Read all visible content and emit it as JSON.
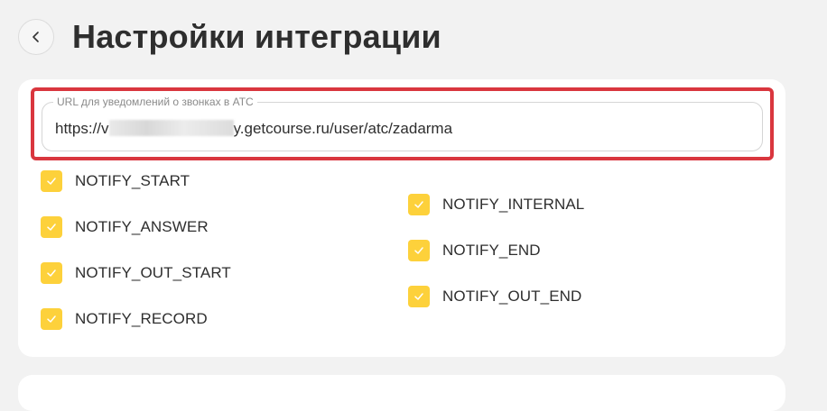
{
  "header": {
    "title": "Настройки интеграции"
  },
  "url_field": {
    "label": "URL для уведомлений о звонках в АТС",
    "value_prefix": "https://v",
    "value_suffix": "y.getcourse.ru/user/atc/zadarma"
  },
  "notifications": {
    "left": [
      {
        "label": "NOTIFY_START",
        "checked": true
      },
      {
        "label": "NOTIFY_ANSWER",
        "checked": true
      },
      {
        "label": "NOTIFY_OUT_START",
        "checked": true
      },
      {
        "label": "NOTIFY_RECORD",
        "checked": true
      }
    ],
    "right": [
      {
        "label": "NOTIFY_INTERNAL",
        "checked": true
      },
      {
        "label": "NOTIFY_END",
        "checked": true
      },
      {
        "label": "NOTIFY_OUT_END",
        "checked": true
      }
    ]
  },
  "colors": {
    "checkbox": "#fdd13b",
    "highlight": "#d9363e",
    "background": "#f2f2f2"
  }
}
